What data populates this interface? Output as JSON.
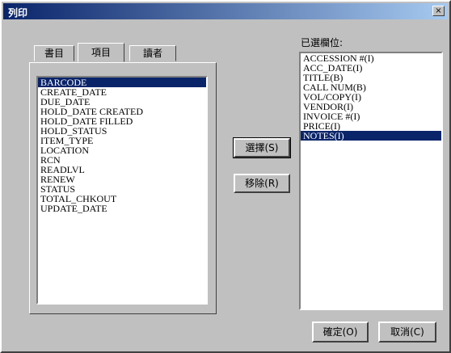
{
  "window": {
    "title": "列印",
    "close_label": "×"
  },
  "tabs": [
    "書目",
    "項目",
    "讀者"
  ],
  "available": {
    "items": [
      "BARCODE",
      "CREATE_DATE",
      "DUE_DATE",
      "HOLD_DATE CREATED",
      "HOLD_DATE FILLED",
      "HOLD_STATUS",
      "ITEM_TYPE",
      "LOCATION",
      "RCN",
      "READLVL",
      "RENEW",
      "STATUS",
      "TOTAL_CHKOUT",
      "UPDATE_DATE"
    ],
    "selected_index": 0
  },
  "buttons": {
    "select": "選擇(S)",
    "remove": "移除(R)",
    "ok": "確定(O)",
    "cancel": "取消(C)"
  },
  "chosen": {
    "label": "已選欄位:",
    "items": [
      "ACCESSION #(I)",
      "ACC_DATE(I)",
      "TITLE(B)",
      "CALL NUM(B)",
      "VOL/COPY(I)",
      "VENDOR(I)",
      "INVOICE #(I)",
      "PRICE(I)",
      "NOTES(I)"
    ],
    "selected_index": 8
  }
}
